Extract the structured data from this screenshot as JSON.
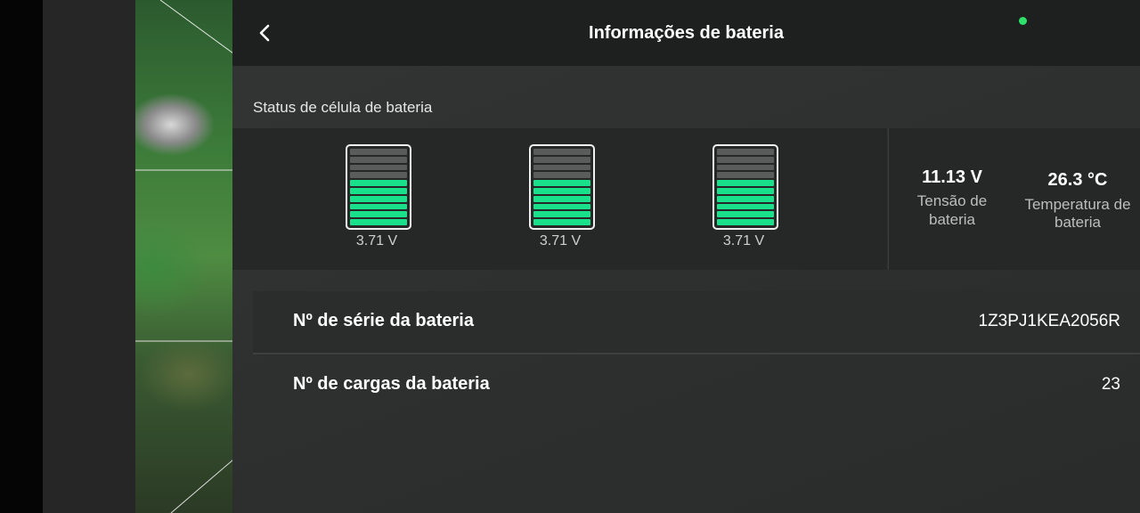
{
  "header": {
    "title": "Informações de bateria",
    "back_icon": "chevron-left-icon",
    "status_color": "#2ee06a"
  },
  "cell_status": {
    "section_label": "Status de célula de bateria",
    "cells": [
      {
        "voltage": "3.71 V",
        "level": 0.6
      },
      {
        "voltage": "3.71 V",
        "level": 0.6
      },
      {
        "voltage": "3.71 V",
        "level": 0.6
      }
    ],
    "fill_color": "#19e08a",
    "empty_color": "#5a5c5c"
  },
  "stats": {
    "voltage_value": "11.13 V",
    "voltage_label": "Tensão de bateria",
    "temp_value": "26.3 °C",
    "temp_label": "Temperatura de bateria"
  },
  "info_rows": [
    {
      "label": "Nº de série da bateria",
      "value": "1Z3PJ1KEA2056R"
    },
    {
      "label": "Nº de cargas da bateria",
      "value": "23"
    }
  ]
}
